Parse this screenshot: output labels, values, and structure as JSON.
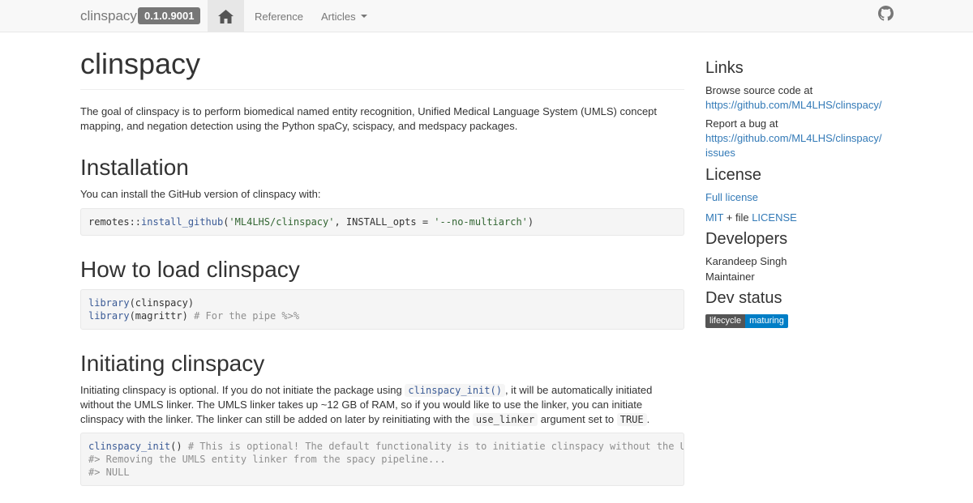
{
  "navbar": {
    "brand": "clinspacy",
    "version": "0.1.0.9001",
    "home_icon": "home-icon",
    "links": [
      {
        "label": "Reference"
      },
      {
        "label": "Articles"
      }
    ],
    "github_icon": "github-icon"
  },
  "main": {
    "title": "clinspacy",
    "intro": "The goal of clinspacy is to perform biomedical named entity recognition, Unified Medical Language System (UMLS) concept mapping, and negation detection using the Python spaCy, scispacy, and medspacy packages.",
    "installation": {
      "heading": "Installation",
      "text": "You can install the GitHub version of clinspacy with:",
      "code": {
        "pkg": "remotes",
        "sep": "::",
        "fn": "install_github",
        "open": "(",
        "arg1": "'ML4LHS/clinspacy'",
        "mid": ", INSTALL_opts = ",
        "arg2": "'--no-multiarch'",
        "close": ")"
      }
    },
    "load": {
      "heading": "How to load clinspacy",
      "line1_fn": "library",
      "line1_rest": "(clinspacy)",
      "line2_fn": "library",
      "line2_rest": "(magrittr) ",
      "line2_comment": "# For the pipe %>%"
    },
    "init": {
      "heading": "Initiating clinspacy",
      "p_part1": "Initiating clinspacy is optional. If you do not initiate the package using ",
      "p_code1": "clinspacy_init()",
      "p_part2": ", it will be automatically initiated without the UMLS linker. The UMLS linker takes up ~12 GB of RAM, so if you would like to use the linker, you can initiate clinspacy with the linker. The linker can still be added on later by reinitiating with the ",
      "p_code2": "use_linker",
      "p_part3": " argument set to ",
      "p_code3": "TRUE",
      "p_part4": ".",
      "code_fn": "clinspacy_init",
      "code_paren": "() ",
      "code_comment": "# This is optional! The default functionality is to initiatie clinspacy without the UMLS linker",
      "out1": "#> Removing the UMLS entity linker from the spacy pipeline...",
      "out2": "#> NULL"
    }
  },
  "sidebar": {
    "links": {
      "heading": "Links",
      "browse_label": "Browse source code at",
      "browse_url": "https://github.com/ML4LHS/clinspacy/",
      "bug_label": "Report a bug at",
      "bug_url_line1": "https://github.com/ML4LHS/clinspacy/",
      "bug_url_line2": "issues"
    },
    "license": {
      "heading": "License",
      "full": "Full license",
      "mit": "MIT",
      "plus": " + file ",
      "file": "LICENSE"
    },
    "developers": {
      "heading": "Developers",
      "name": "Karandeep Singh",
      "role": "Maintainer"
    },
    "dev_status": {
      "heading": "Dev status",
      "badge_left": "lifecycle",
      "badge_right": "maturing"
    }
  }
}
